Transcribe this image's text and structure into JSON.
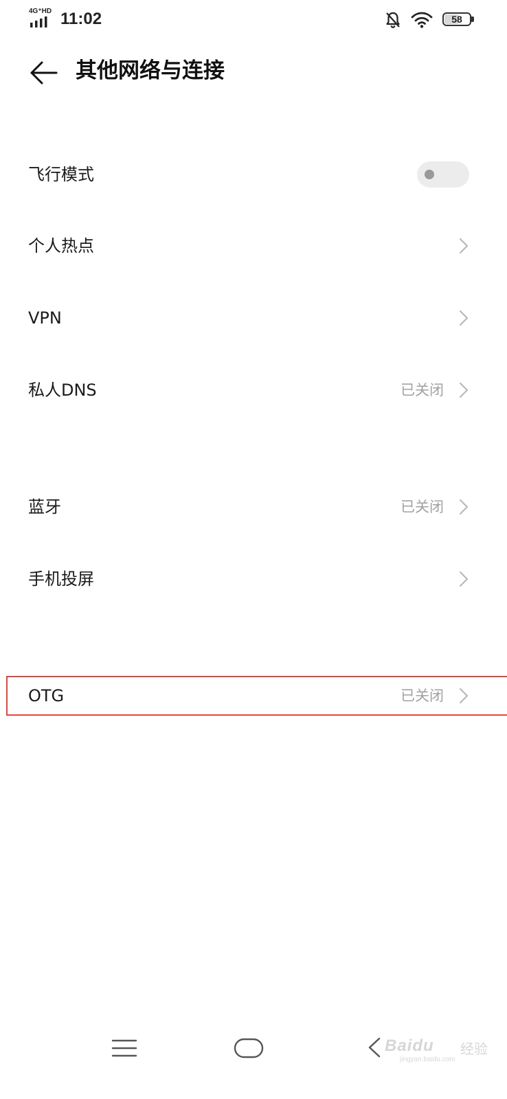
{
  "status_bar": {
    "network_label": "4G⁺HD",
    "time": "11:02",
    "battery_level": "58",
    "battery_fraction": 0.58,
    "icons": [
      "signal-icon",
      "bell-off-icon",
      "wifi-icon",
      "battery-icon"
    ]
  },
  "header": {
    "title": "其他网络与连接",
    "back_icon": "arrow-left-icon"
  },
  "settings": {
    "airplane_mode": {
      "label": "飞行模式",
      "enabled": false
    },
    "hotspot": {
      "label": "个人热点"
    },
    "vpn": {
      "label": "VPN"
    },
    "private_dns": {
      "label": "私人DNS",
      "value": "已关闭"
    },
    "bluetooth": {
      "label": "蓝牙",
      "value": "已关闭"
    },
    "screen_cast": {
      "label": "手机投屏"
    },
    "otg": {
      "label": "OTG",
      "value": "已关闭"
    }
  },
  "highlight_color": "#e0463d",
  "nav_bar": {
    "icons": [
      "menu-icon",
      "home-icon",
      "back-icon"
    ]
  },
  "watermark": {
    "brand": "Baidu",
    "cn": "经验",
    "url": "jingyan.baidu.com"
  }
}
